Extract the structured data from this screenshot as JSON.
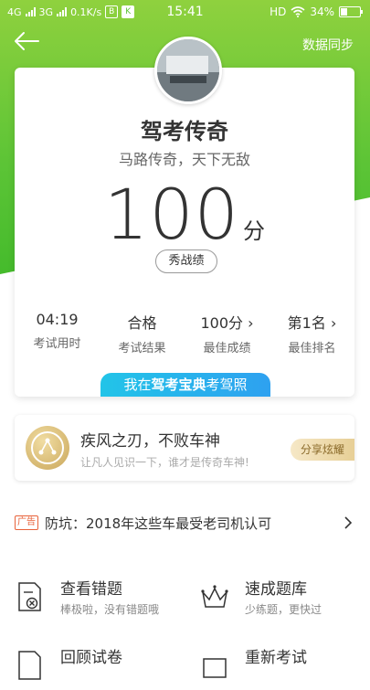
{
  "status_bar": {
    "net1": "4G",
    "net2": "3G",
    "speed": "0.1K/s",
    "time": "15:41",
    "hd": "HD",
    "battery": "34%",
    "battery_level": 0.34
  },
  "nav": {
    "sync_label": "数据同步"
  },
  "profile": {
    "title": "驾考传奇",
    "subtitle": "马路传奇，天下无敌",
    "score": "100",
    "score_unit": "分",
    "show_button": "秀战绩"
  },
  "stats": [
    {
      "value": "04:19",
      "label": "考试用时"
    },
    {
      "value": "合格",
      "label": "考试结果"
    },
    {
      "value": "100分",
      "label": "最佳成绩"
    },
    {
      "value": "第1名",
      "label": "最佳排名"
    }
  ],
  "promo": {
    "prefix": "我在",
    "highlight": "驾考宝典",
    "suffix": "考驾照"
  },
  "achievement": {
    "title": "疾风之刃，不败车神",
    "subtitle": "让凡人见识一下，谁才是传奇车神!",
    "share_button": "分享炫耀"
  },
  "ad": {
    "tag": "广告",
    "text": "防坑：2018年这些车最受老司机认可"
  },
  "features": [
    {
      "title": "查看错题",
      "subtitle": "棒极啦，没有错题哦"
    },
    {
      "title": "速成题库",
      "subtitle": "少练题，更快过"
    },
    {
      "title": "回顾试卷",
      "subtitle": ""
    },
    {
      "title": "重新考试",
      "subtitle": ""
    }
  ],
  "colors": {
    "green": "#5cc436",
    "promo_blue": "#22c4e8",
    "ad_orange": "#e8623a",
    "gold": "#c9a65a"
  }
}
